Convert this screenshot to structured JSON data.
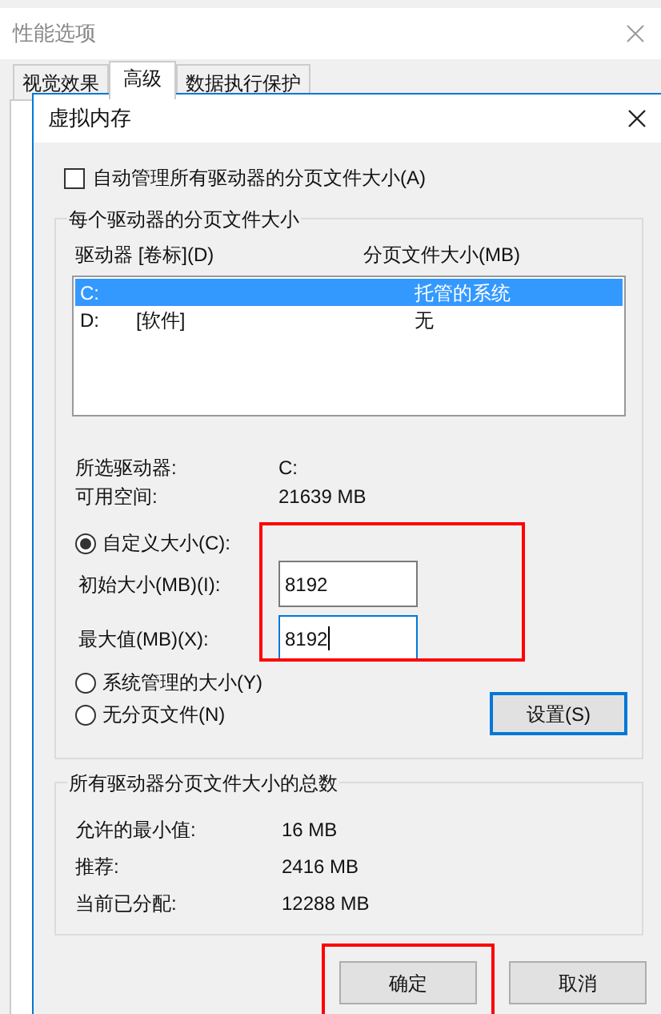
{
  "window": {
    "title": "性能选项"
  },
  "tabs": [
    {
      "label": "视觉效果",
      "selected": false
    },
    {
      "label": "高级",
      "selected": true
    },
    {
      "label": "数据执行保护",
      "selected": false
    }
  ],
  "dialog": {
    "title": "虚拟内存",
    "auto_manage": {
      "label": "自动管理所有驱动器的分页文件大小(A)",
      "checked": false
    },
    "per_drive": {
      "title": "每个驱动器的分页文件大小",
      "columns": [
        "驱动器 [卷标](D)",
        "分页文件大小(MB)"
      ],
      "rows": [
        {
          "drive": "C:",
          "size": "托管的系统",
          "selected": true
        },
        {
          "drive": "D:",
          "label": "[软件]",
          "size": "无",
          "selected": false
        }
      ],
      "info": [
        {
          "label": "所选驱动器:",
          "value": "C:"
        },
        {
          "label": "可用空间:",
          "value": "21639 MB"
        }
      ],
      "options": [
        {
          "label": "自定义大小(C):",
          "selected": true
        },
        {
          "label": "系统管理的大小(Y)",
          "selected": false
        },
        {
          "label": "无分页文件(N)",
          "selected": false
        }
      ],
      "fields": [
        {
          "label": "初始大小(MB)(I):",
          "value": "8192",
          "focused": false
        },
        {
          "label": "最大值(MB)(X):",
          "value": "8192",
          "focused": true
        }
      ],
      "fields_highlighted": true,
      "set_button": "设置(S)"
    },
    "totals": {
      "title": "所有驱动器分页文件大小的总数",
      "rows": [
        {
          "label": "允许的最小值:",
          "value": "16 MB"
        },
        {
          "label": "推荐:",
          "value": "2416 MB"
        },
        {
          "label": "当前已分配:",
          "value": "12288 MB"
        }
      ]
    },
    "buttons": [
      {
        "label": "确定",
        "highlighted": true
      },
      {
        "label": "取消",
        "highlighted": false
      }
    ]
  }
}
